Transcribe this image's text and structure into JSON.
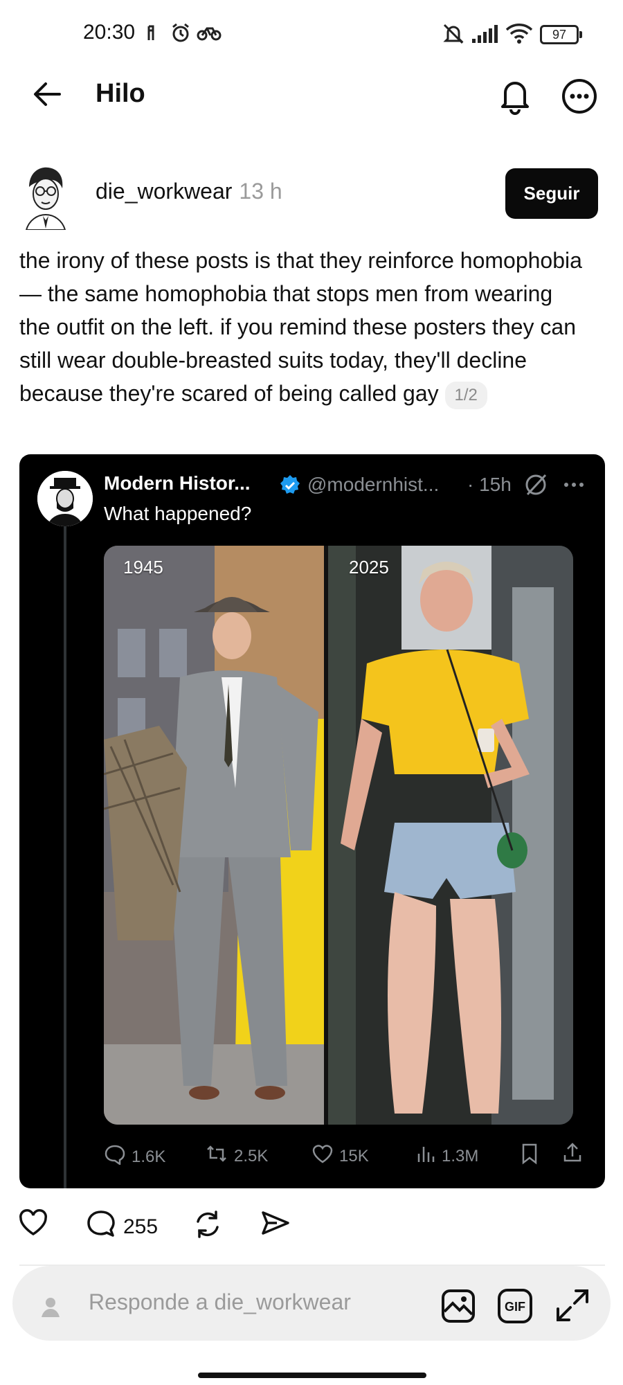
{
  "status_bar": {
    "time": "20:30",
    "battery": "97"
  },
  "header": {
    "title": "Hilo"
  },
  "post": {
    "username": "die_workwear",
    "time": "13 h",
    "follow_label": "Seguir",
    "text": "the irony of these posts is that they reinforce homophobia — the same homophobia that stops men from wearing the outfit on the left. if you remind these posters they can still wear double-breasted suits today, they'll decline because they're scared of being called gay",
    "page_indicator": "1/2",
    "embed": {
      "name": "Modern Histor...",
      "handle": "@modernhist...",
      "time": "· 15h",
      "text": "What happened?",
      "photo_labels": [
        "1945",
        "2025"
      ],
      "stats": {
        "replies": "1.6K",
        "reposts": "2.5K",
        "likes": "15K",
        "views": "1.3M"
      }
    },
    "actions": {
      "reply_count": "255"
    }
  },
  "reply_bar": {
    "placeholder": "Responde a die_workwear"
  },
  "colors": {
    "verified_blue": "#1d9bf0",
    "follow_bg": "#0a0a0a",
    "muted": "#9a9a9a"
  }
}
